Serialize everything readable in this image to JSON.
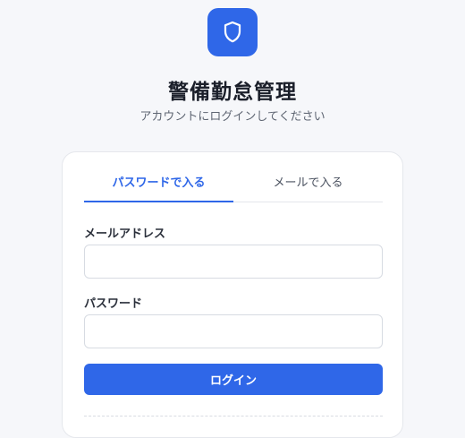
{
  "app": {
    "title": "警備勤怠管理",
    "subtitle": "アカウントにログインしてください",
    "brand_color": "#2f67e8",
    "logo_icon": "shield-icon"
  },
  "tabs": [
    {
      "label": "パスワードで入る",
      "active": true
    },
    {
      "label": "メールで入る",
      "active": false
    }
  ],
  "form": {
    "email": {
      "label": "メールアドレス",
      "value": "",
      "placeholder": ""
    },
    "password": {
      "label": "パスワード",
      "value": "",
      "placeholder": ""
    },
    "submit_label": "ログイン"
  }
}
